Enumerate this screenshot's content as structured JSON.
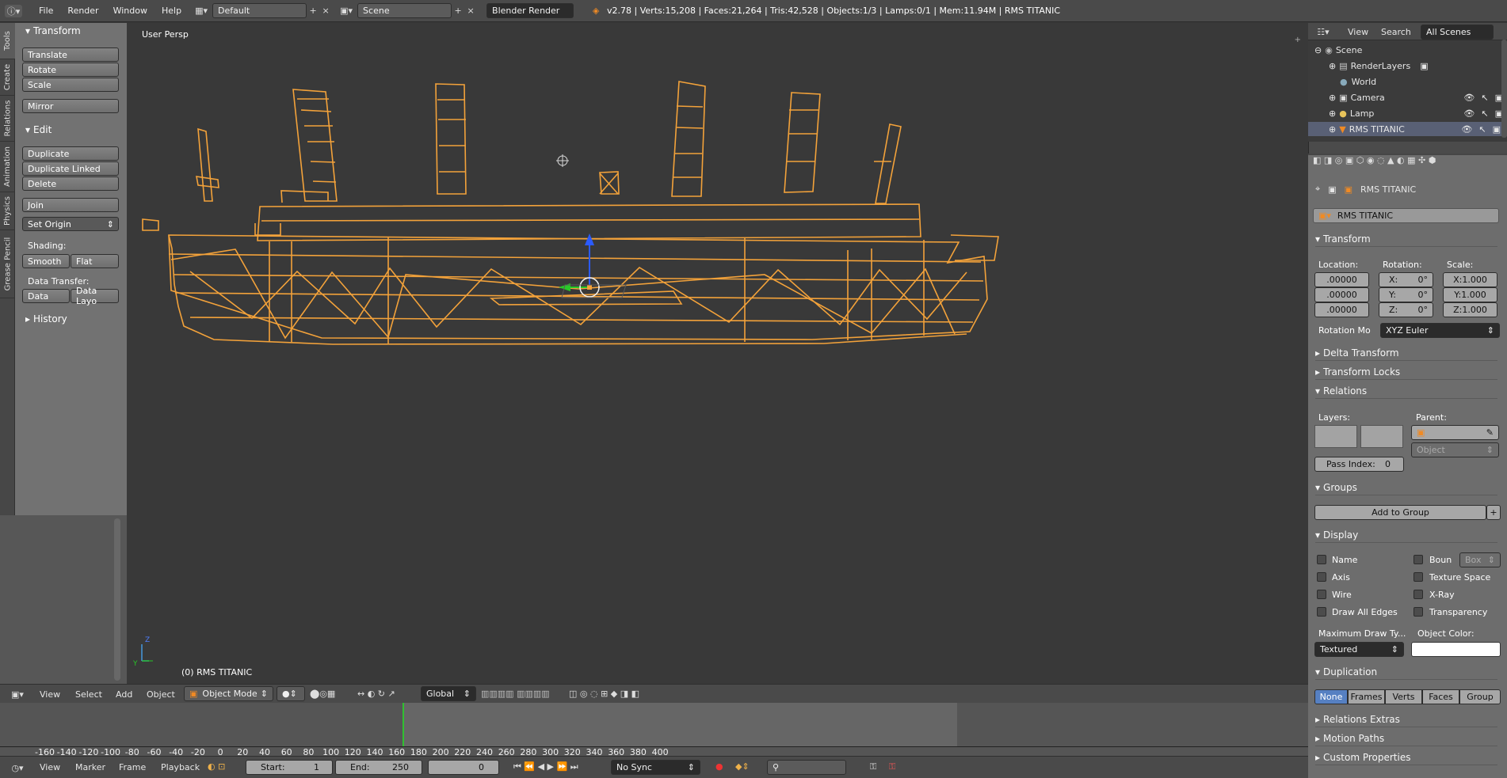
{
  "topbar": {
    "menus": [
      "File",
      "Render",
      "Window",
      "Help"
    ],
    "layout": "Default",
    "scene": "Scene",
    "engine": "Blender Render",
    "stats": "v2.78 | Verts:15,208 | Faces:21,264 | Tris:42,528 | Objects:1/3 | Lamps:0/1 | Mem:11.94M | RMS TITANIC"
  },
  "toolshelf": {
    "tabs": [
      "Tools",
      "Create",
      "Relations",
      "Animation",
      "Physics",
      "Grease Pencil"
    ],
    "transform_header": "Transform",
    "transform_buttons": [
      "Translate",
      "Rotate",
      "Scale",
      "Mirror"
    ],
    "edit_header": "Edit",
    "edit_buttons": [
      "Duplicate",
      "Duplicate Linked",
      "Delete",
      "Join"
    ],
    "set_origin": "Set Origin",
    "shading_label": "Shading:",
    "smooth": "Smooth",
    "flat": "Flat",
    "data_transfer_label": "Data Transfer:",
    "data": "Data",
    "data_layo": "Data Layo",
    "history": "History"
  },
  "viewport": {
    "view_label": "User Persp",
    "object_label": "(0) RMS TITANIC"
  },
  "outliner": {
    "view": "View",
    "search": "Search",
    "all_scenes": "All Scenes",
    "items": [
      "Scene",
      "RenderLayers",
      "World",
      "Camera",
      "Lamp",
      "RMS TITANIC"
    ]
  },
  "properties": {
    "object_name": "RMS TITANIC",
    "transform": "Transform",
    "location": "Location:",
    "rotation": "Rotation:",
    "scale": "Scale:",
    "loc_values": [
      ".00000",
      ".00000",
      ".00000"
    ],
    "rot_values": [
      "X:",
      "Y:",
      "Z:"
    ],
    "rot_deg": [
      "0°",
      "0°",
      "0°"
    ],
    "scale_values": [
      "X:1.000",
      "Y:1.000",
      "Z:1.000"
    ],
    "rotation_mode_label": "Rotation Mo",
    "rotation_mode": "XYZ Euler",
    "delta": "Delta Transform",
    "locks": "Transform Locks",
    "relations": "Relations",
    "layers": "Layers:",
    "parent": "Parent:",
    "object": "Object",
    "pass_index": "Pass Index:",
    "pass_index_value": "0",
    "groups": "Groups",
    "add_group": "Add to Group",
    "display": "Display",
    "name": "Name",
    "axis": "Axis",
    "wire": "Wire",
    "draw_all_edges": "Draw All Edges",
    "boun": "Boun",
    "box": "Box",
    "texture_space": "Texture Space",
    "xray": "X-Ray",
    "transparency": "Transparency",
    "max_draw": "Maximum Draw Ty...",
    "object_color": "Object Color:",
    "textured": "Textured",
    "duplication": "Duplication",
    "dup_buttons": [
      "None",
      "Frames",
      "Verts",
      "Faces",
      "Group"
    ],
    "relations_extras": "Relations Extras",
    "motion_paths": "Motion Paths",
    "custom_properties": "Custom Properties"
  },
  "bottom_toolbar": {
    "view": "View",
    "select": "Select",
    "add": "Add",
    "object": "Object",
    "mode": "Object Mode",
    "orientation": "Global"
  },
  "timeline": {
    "ticks": [
      "-160",
      "-140",
      "-120",
      "-100",
      "-80",
      "-60",
      "-40",
      "-20",
      "0",
      "20",
      "40",
      "60",
      "80",
      "100",
      "120",
      "140",
      "160",
      "180",
      "200",
      "220",
      "240",
      "260",
      "280",
      "300",
      "320",
      "340",
      "360",
      "380",
      "400"
    ],
    "menus": [
      "View",
      "Marker",
      "Frame",
      "Playback"
    ],
    "start": "Start:",
    "start_value": "1",
    "end": "End:",
    "end_value": "250",
    "frame": "0",
    "sync": "No Sync"
  }
}
